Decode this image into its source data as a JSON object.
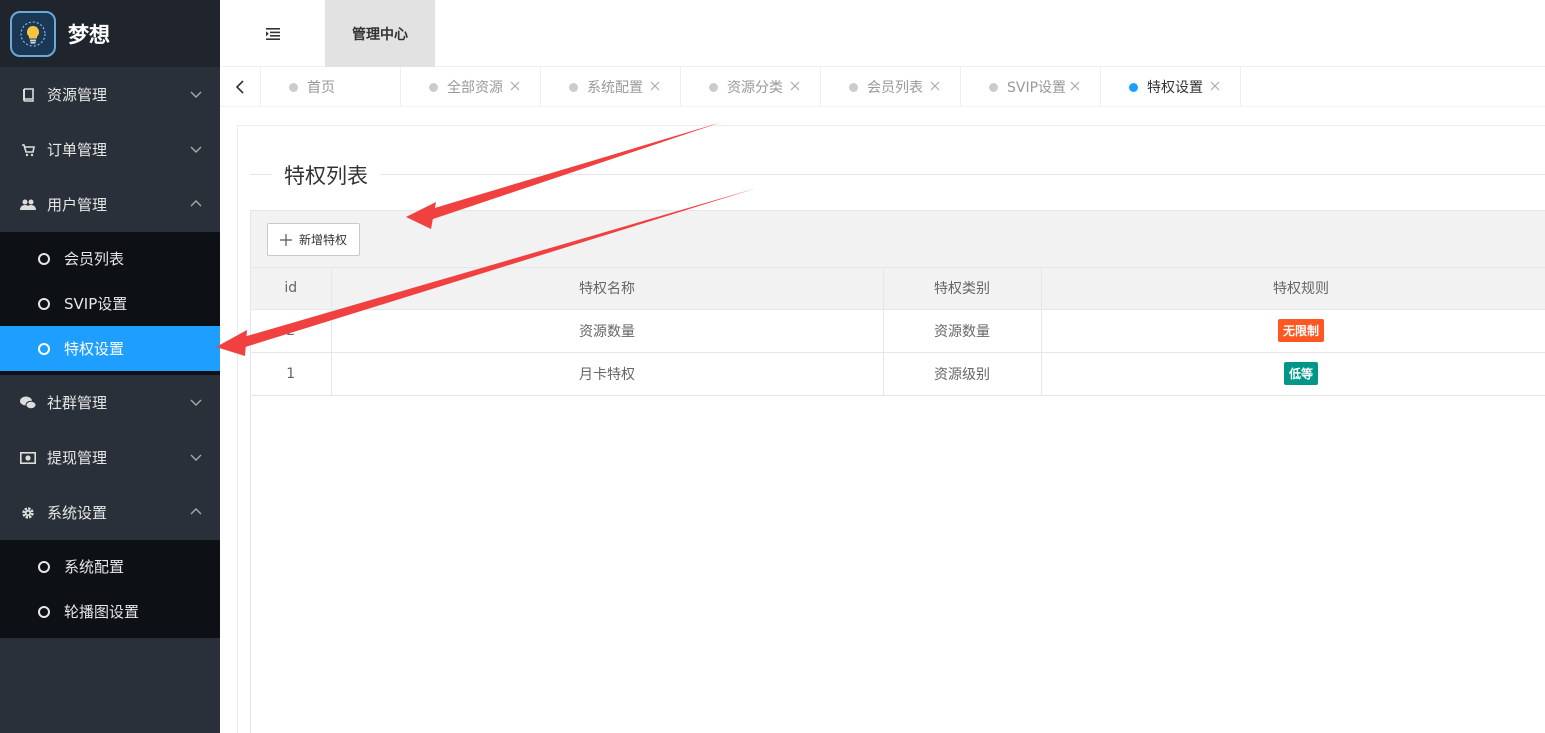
{
  "app": {
    "title": "梦想"
  },
  "sidebar": {
    "menus": [
      {
        "label": "资源管理",
        "icon": "book-icon",
        "expanded": false
      },
      {
        "label": "订单管理",
        "icon": "cart-icon",
        "expanded": false
      },
      {
        "label": "用户管理",
        "icon": "users-icon",
        "expanded": true,
        "children": [
          "会员列表",
          "SVIP设置",
          "特权设置"
        ]
      },
      {
        "label": "社群管理",
        "icon": "chat-icon",
        "expanded": false
      },
      {
        "label": "提现管理",
        "icon": "money-icon",
        "expanded": false
      },
      {
        "label": "系统设置",
        "icon": "gear-icon",
        "expanded": true,
        "children": [
          "系统配置",
          "轮播图设置"
        ]
      }
    ],
    "active_item": "特权设置"
  },
  "header": {
    "active_nav": "管理中心"
  },
  "tabs": [
    {
      "label": "首页",
      "closable": false
    },
    {
      "label": "全部资源",
      "closable": true
    },
    {
      "label": "系统配置",
      "closable": true
    },
    {
      "label": "资源分类",
      "closable": true
    },
    {
      "label": "会员列表",
      "closable": true
    },
    {
      "label": "SVIP设置",
      "closable": true
    },
    {
      "label": "特权设置",
      "closable": true,
      "active": true
    }
  ],
  "content": {
    "title": "特权列表",
    "add_button": "新增特权",
    "table": {
      "headers": [
        "id",
        "特权名称",
        "特权类别",
        "特权规则"
      ],
      "rows": [
        {
          "id": "2",
          "name": "资源数量",
          "category": "资源数量",
          "rule": "无限制",
          "rule_color": "#ff5722"
        },
        {
          "id": "1",
          "name": "月卡特权",
          "category": "资源级别",
          "rule": "低等",
          "rule_color": "#009688"
        }
      ]
    }
  },
  "colors": {
    "accent": "#1e9fff",
    "sidebar_bg": "#2a303a",
    "annotation_arrow": "#f04040"
  }
}
